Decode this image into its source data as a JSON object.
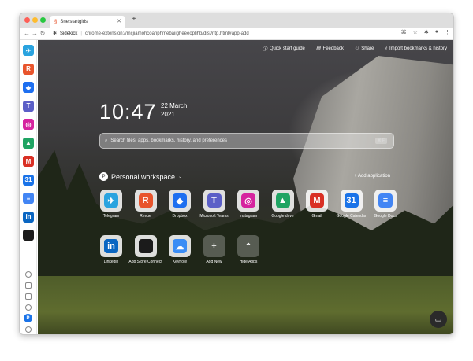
{
  "browser": {
    "tab_title": "Snelstartgids",
    "new_tab": "+",
    "url_label": "Sidekick",
    "url_path": "chrome-extension://mcjiamohcoanphmebaiigheeeoplihb/dist/ntp.html#app-add"
  },
  "header": {
    "links": [
      {
        "label": "Quick start guide",
        "icon": "info-icon"
      },
      {
        "label": "Feedback",
        "icon": "feedback-icon"
      },
      {
        "label": "Share",
        "icon": "share-icon"
      },
      {
        "label": "Import bookmarks & history",
        "icon": "import-icon"
      }
    ]
  },
  "clock": {
    "time": "10:47",
    "date_line1": "22 March,",
    "date_line2": "2021"
  },
  "search": {
    "placeholder": "Search files, apps, bookmarks, history, and preferences",
    "shortcut": "⌘ F"
  },
  "workspace": {
    "avatar_letter": "P",
    "title": "Personal workspace",
    "add_label": "+ Add application"
  },
  "apps_row1": [
    {
      "label": "Telegram",
      "symbol": "✈",
      "color": "#2aa3df"
    },
    {
      "label": "Revue",
      "symbol": "R",
      "color": "#e8542c"
    },
    {
      "label": "Dropbox",
      "symbol": "◆",
      "color": "#1e6ff0"
    },
    {
      "label": "Microsoft Teams",
      "symbol": "T",
      "color": "#5b5fc7"
    },
    {
      "label": "Instagram",
      "symbol": "◎",
      "color": "#d6249f"
    },
    {
      "label": "Google drive",
      "symbol": "▲",
      "color": "#1fa463"
    },
    {
      "label": "Gmail",
      "symbol": "M",
      "color": "#d93025"
    },
    {
      "label": "Google Calendar",
      "symbol": "31",
      "color": "#1a73e8"
    },
    {
      "label": "Google Docs",
      "symbol": "≡",
      "color": "#4285f4"
    }
  ],
  "apps_row2": [
    {
      "label": "Linkedin",
      "symbol": "in",
      "color": "#0a66c2"
    },
    {
      "label": "App Store Connect",
      "symbol": "",
      "color": "#1b1b1b"
    },
    {
      "label": "Keynote",
      "symbol": "☁",
      "color": "#3a8df5"
    },
    {
      "label": "Add New",
      "symbol": "+",
      "color": "transparent"
    },
    {
      "label": "Hide Apps",
      "symbol": "⌃",
      "color": "transparent"
    }
  ],
  "sidebar": {
    "apps": [
      {
        "symbol": "✈",
        "color": "#2aa3df"
      },
      {
        "symbol": "R",
        "color": "#e8542c"
      },
      {
        "symbol": "◆",
        "color": "#1e6ff0"
      },
      {
        "symbol": "T",
        "color": "#5b5fc7"
      },
      {
        "symbol": "◎",
        "color": "#d6249f"
      },
      {
        "symbol": "▲",
        "color": "#1fa463"
      },
      {
        "symbol": "M",
        "color": "#d93025"
      },
      {
        "symbol": "31",
        "color": "#1a73e8"
      },
      {
        "symbol": "≡",
        "color": "#4285f4"
      },
      {
        "symbol": "in",
        "color": "#0a66c2"
      },
      {
        "symbol": "",
        "color": "#1b1b1b"
      }
    ],
    "profile_letter": "P"
  },
  "chat": {
    "symbol": "▭"
  }
}
